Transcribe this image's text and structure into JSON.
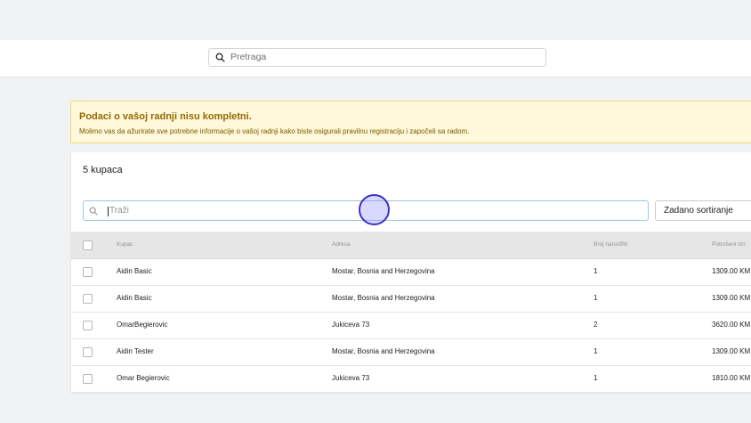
{
  "header": {
    "search_placeholder": "Pretraga"
  },
  "banner": {
    "title": "Podaci o vašoj radnji nisu kompletni.",
    "message": "Molimo vas da ažurirate sve potrebne informacije o vašoj radnji kako biste osigurali pravilnu registraciju i započeli sa radom."
  },
  "customers": {
    "count_label": "5 kupaca",
    "search_placeholder": "Traži",
    "sort_label": "Zadano sortiranje",
    "columns": {
      "customer": "Kupac",
      "address": "Adresa",
      "orders": "Broj narudžbi",
      "spent": "Potrošeni izn"
    },
    "rows": [
      {
        "name": "Aidin Basic",
        "address": "Mostar, Bosnia and Herzegovina",
        "orders": "1",
        "spent": "1309.00 KM"
      },
      {
        "name": "Aidin Basic",
        "address": "Mostar, Bosnia and Herzegovina",
        "orders": "1",
        "spent": "1309.00 KM"
      },
      {
        "name": "OmarBegierovic",
        "address": "Jukiceva 73",
        "orders": "2",
        "spent": "3620.00 KM"
      },
      {
        "name": "Aidin Tester",
        "address": "Mostar, Bosnia and Herzegovina",
        "orders": "1",
        "spent": "1309.00 KM"
      },
      {
        "name": "Omar Begierovic",
        "address": "Jukiceva 73",
        "orders": "1",
        "spent": "1810.00 KM"
      }
    ]
  }
}
